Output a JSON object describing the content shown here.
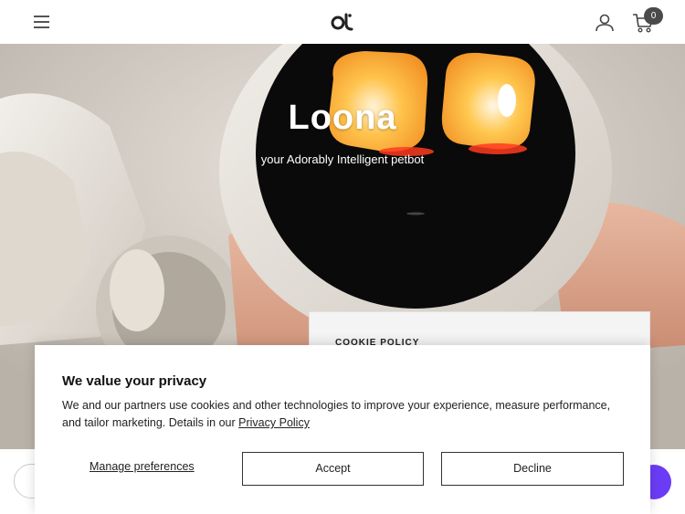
{
  "header": {
    "cart_count": "0",
    "icons": [
      "menu-icon",
      "logo-icon",
      "account-icon",
      "cart-icon"
    ]
  },
  "hero": {
    "title": "Loona",
    "subtitle": "your Adorably Intelligent petbot"
  },
  "cookie_panel": {
    "label": "COOKIE POLICY"
  },
  "privacy": {
    "title": "We value your privacy",
    "text": "We and our partners use cookies and other technologies to improve your experience, measure performance, and tailor marketing. Details in our ",
    "link_label": "Privacy Policy",
    "manage_label": "Manage preferences",
    "accept_label": "Accept",
    "decline_label": "Decline"
  },
  "colors": {
    "accent": "#6b3cf5",
    "badge": "#4a4a4a",
    "eye_glow": "#f5a623",
    "screen": "#0a0a0a"
  }
}
